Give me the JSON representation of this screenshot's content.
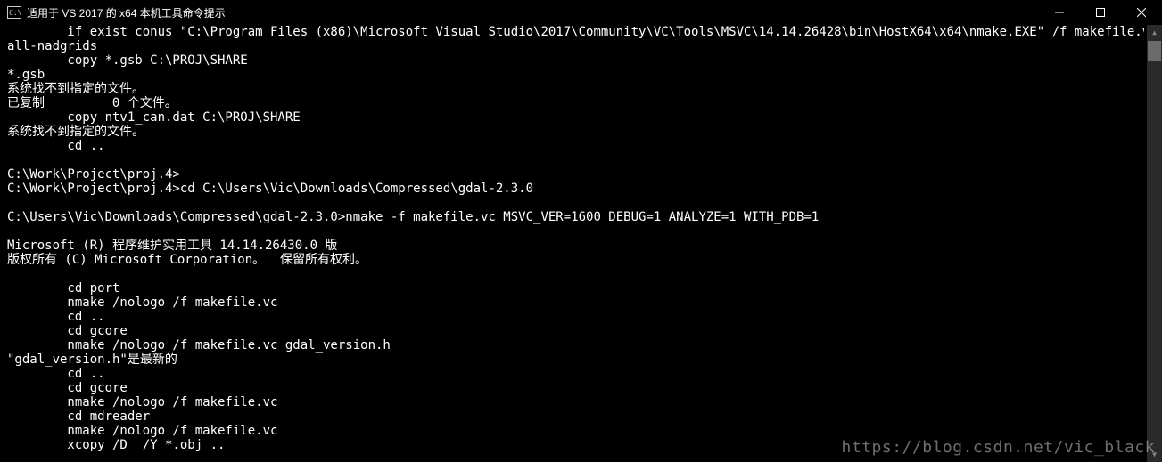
{
  "window": {
    "title": "适用于 VS 2017 的 x64 本机工具命令提示"
  },
  "terminal": {
    "lines": [
      "        if exist conus \"C:\\Program Files (x86)\\Microsoft Visual Studio\\2017\\Community\\VC\\Tools\\MSVC\\14.14.26428\\bin\\HostX64\\x64\\nmake.EXE\" /f makefile.vc inst",
      "all-nadgrids",
      "        copy *.gsb C:\\PROJ\\SHARE",
      "*.gsb",
      "系统找不到指定的文件。",
      "已复制         0 个文件。",
      "        copy ntv1_can.dat C:\\PROJ\\SHARE",
      "系统找不到指定的文件。",
      "        cd ..",
      "",
      "C:\\Work\\Project\\proj.4>",
      "C:\\Work\\Project\\proj.4>cd C:\\Users\\Vic\\Downloads\\Compressed\\gdal-2.3.0",
      "",
      "C:\\Users\\Vic\\Downloads\\Compressed\\gdal-2.3.0>nmake -f makefile.vc MSVC_VER=1600 DEBUG=1 ANALYZE=1 WITH_PDB=1",
      "",
      "Microsoft (R) 程序维护实用工具 14.14.26430.0 版",
      "版权所有 (C) Microsoft Corporation。  保留所有权利。",
      "",
      "        cd port",
      "        nmake /nologo /f makefile.vc",
      "        cd ..",
      "        cd gcore",
      "        nmake /nologo /f makefile.vc gdal_version.h",
      "\"gdal_version.h\"是最新的",
      "        cd ..",
      "        cd gcore",
      "        nmake /nologo /f makefile.vc",
      "        cd mdreader",
      "        nmake /nologo /f makefile.vc",
      "        xcopy /D  /Y *.obj .."
    ]
  },
  "watermark": "https://blog.csdn.net/vic_black"
}
